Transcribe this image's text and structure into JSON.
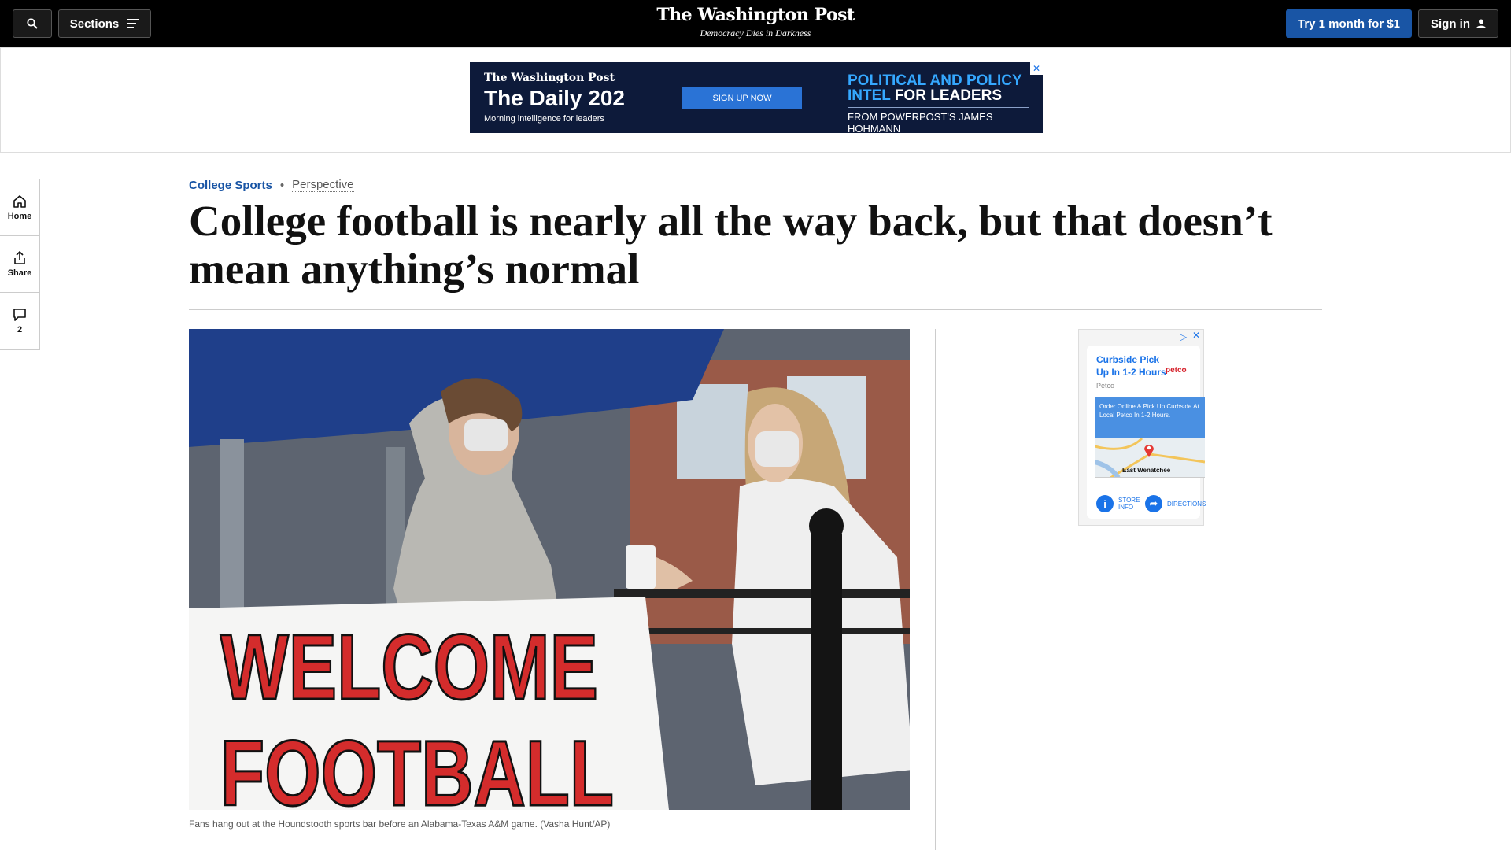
{
  "nav": {
    "sections_label": "Sections",
    "logo": "The Washington Post",
    "tagline": "Democracy Dies in Darkness",
    "trial_label": "Try 1 month for $1",
    "signin_label": "Sign in"
  },
  "top_ad": {
    "logo": "The Washington Post",
    "title": "The Daily 202",
    "subtitle": "Morning intelligence for leaders",
    "cta": "SIGN UP NOW",
    "headline_line1": "POLITICAL AND POLICY",
    "headline_line2_blue": "INTEL",
    "headline_line2_white": "FOR LEADERS",
    "byline": "FROM POWERPOST'S JAMES HOHMANN",
    "colors": {
      "background": "#0d1a3a",
      "accent": "#35a8ff",
      "button": "#2a73d6"
    }
  },
  "left_rail": {
    "home_label": "Home",
    "share_label": "Share",
    "comment_count": "2"
  },
  "article": {
    "section": "College Sports",
    "label": "Perspective",
    "headline": "College football is nearly all the way back, but that doesn’t mean anything’s normal",
    "image_sign_line1": "WELCOME",
    "image_sign_line2": "FOOTBALL",
    "caption": "Fans hang out at the Houndstooth sports bar before an Alabama-Texas A&M game. (Vasha Hunt/AP)"
  },
  "side_ad": {
    "title": "Curbside Pick Up In 1-2 Hours",
    "brand": "petco",
    "source": "Petco",
    "promo": "Order Online & Pick Up Curbside At Local Petco In 1-2 Hours.",
    "map_label": "East Wenatchee",
    "store_info": "STORE INFO",
    "directions": "DIRECTIONS"
  },
  "colors": {
    "nav_bg": "#000000",
    "brand_blue": "#1955a5"
  }
}
